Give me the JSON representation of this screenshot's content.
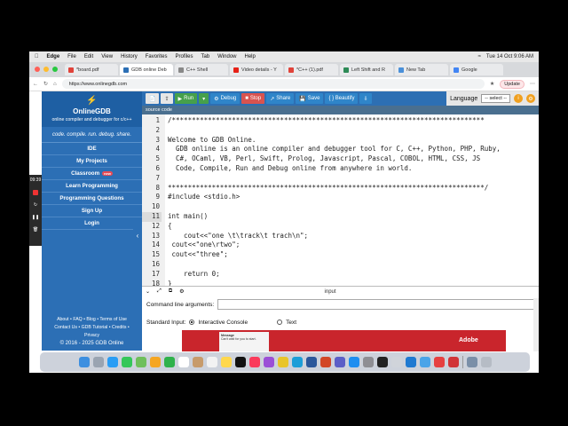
{
  "menubar": {
    "items": [
      "Edge",
      "File",
      "Edit",
      "View",
      "History",
      "Favorites",
      "Profiles",
      "Tab",
      "Window",
      "Help"
    ],
    "clock": "Tue 14 Oct 9:06 AM"
  },
  "tabs": [
    {
      "label": "*board.pdf",
      "color": "#e0433a"
    },
    {
      "label": "GDB online Deb",
      "color": "#2c6fb5"
    },
    {
      "label": "C++ Shell",
      "color": "#555555"
    },
    {
      "label": "Video details - Y",
      "color": "#e62117"
    },
    {
      "label": "*C++ (1).pdf",
      "color": "#e0433a"
    },
    {
      "label": "Left Shift and R",
      "color": "#2e8b57"
    },
    {
      "label": "New Tab",
      "color": "#4a90d9"
    },
    {
      "label": "Google",
      "color": "#4285f4"
    }
  ],
  "address": {
    "url": "https://www.onlinegdb.com",
    "update_label": "Update"
  },
  "sidebar": {
    "title": "OnlineGDB",
    "subtitle": "online compiler and debugger for c/c++",
    "tagline": "code. compile. run. debug. share.",
    "items": [
      {
        "label": "IDE"
      },
      {
        "label": "My Projects"
      },
      {
        "label": "Classroom",
        "badge": "new"
      },
      {
        "label": "Learn Programming"
      },
      {
        "label": "Programming Questions"
      },
      {
        "label": "Sign Up"
      },
      {
        "label": "Login"
      }
    ],
    "footer_line1": "About • FAQ • Blog • Terms of Use",
    "footer_line2": "Contact Us • GDB Tutorial • Credits •",
    "footer_line3": "Privacy",
    "footer_line4": "© 2016 - 2025 GDB Online"
  },
  "toolbar": {
    "run": "Run",
    "debug": "Debug",
    "stop": "Stop",
    "share": "Share",
    "save": "Save",
    "beautify": "{ } Beautify",
    "language_label": "Language",
    "language_value": "-- select --"
  },
  "editor": {
    "label": "source code",
    "lines": [
      {
        "n": "1",
        "text": "/******************************************************************************",
        "cls": "green"
      },
      {
        "n": "2",
        "text": "",
        "cls": ""
      },
      {
        "n": "3",
        "text": "Welcome to GDB Online.",
        "cls": "green"
      },
      {
        "n": "4",
        "text": "  GDB online is an online compiler and debugger tool for C, C++, Python, PHP, Ruby,",
        "cls": "green"
      },
      {
        "n": "5",
        "text": "  C#, OCaml, VB, Perl, Swift, Prolog, Javascript, Pascal, COBOL, HTML, CSS, JS",
        "cls": "green"
      },
      {
        "n": "6",
        "text": "  Code, Compile, Run and Debug online from anywhere in world.",
        "cls": "green"
      },
      {
        "n": "7",
        "text": "",
        "cls": ""
      },
      {
        "n": "8",
        "text": "*******************************************************************************/",
        "cls": "green"
      },
      {
        "n": "9",
        "text": "#include <stdio.h>",
        "cls": ""
      },
      {
        "n": "10",
        "text": "",
        "cls": ""
      },
      {
        "n": "11",
        "text": "int main()",
        "cls": ""
      },
      {
        "n": "12",
        "text": "{",
        "cls": ""
      },
      {
        "n": "13",
        "text": "    cout<<\"one \\t\\track\\t trach\\n\";",
        "cls": ""
      },
      {
        "n": "14",
        "text": " cout<<\"one\\rtwo\";",
        "cls": ""
      },
      {
        "n": "15",
        "text": " cout<<\"three\";",
        "cls": ""
      },
      {
        "n": "16",
        "text": "",
        "cls": ""
      },
      {
        "n": "17",
        "text": "    return 0;",
        "cls": ""
      },
      {
        "n": "18",
        "text": "}",
        "cls": ""
      }
    ]
  },
  "io": {
    "input_label": "input",
    "cmd_label": "Command line arguments:",
    "std_label": "Standard Input:",
    "opt1": "Interactive Console",
    "opt2": "Text"
  },
  "ad": {
    "message_title": "Message",
    "message_body": "Can't wait for you to start.",
    "brand": "Adobe"
  },
  "recorder": {
    "time": "09:39"
  }
}
